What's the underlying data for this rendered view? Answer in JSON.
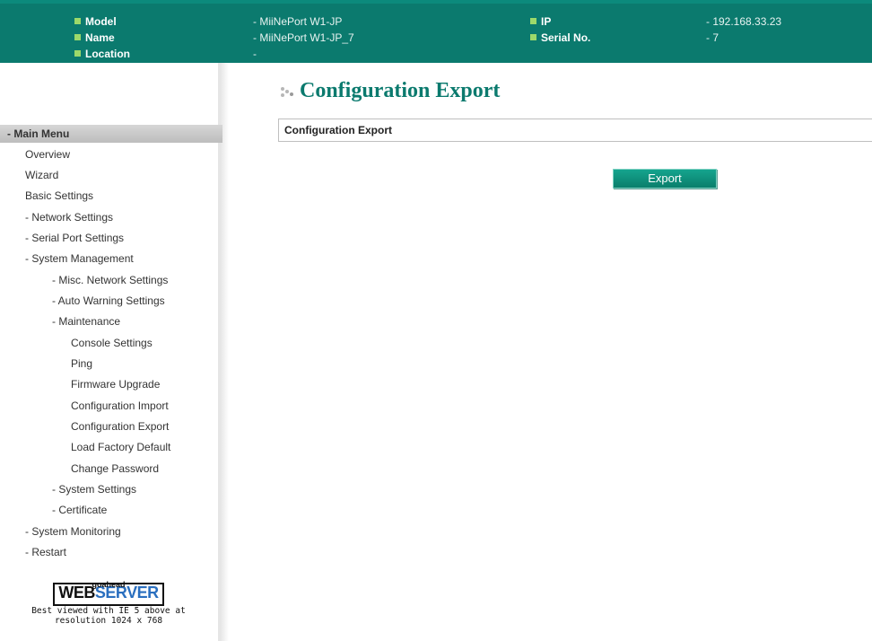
{
  "header": {
    "model_label": "Model",
    "model_value": "- MiiNePort W1-JP",
    "name_label": "Name",
    "name_value": "- MiiNePort W1-JP_7",
    "location_label": "Location",
    "location_value": "-",
    "ip_label": "IP",
    "ip_value": "- 192.168.33.23",
    "serial_label": "Serial No.",
    "serial_value": "- 7"
  },
  "sidebar": {
    "main_menu": "- Main Menu",
    "items": [
      "Overview",
      "Wizard",
      "Basic Settings",
      "- Network Settings",
      "- Serial Port Settings",
      "- System Management",
      "- Misc. Network Settings",
      "- Auto Warning Settings",
      "- Maintenance",
      "Console Settings",
      "Ping",
      "Firmware Upgrade",
      "Configuration Import",
      "Configuration Export",
      "Load Factory Default",
      "Change Password",
      "- System Settings",
      "- Certificate",
      "- System Monitoring",
      "- Restart"
    ]
  },
  "logo": {
    "top": "goahead",
    "web": "WEB",
    "server": "SERVER",
    "note_line1": "Best viewed with IE 5 above at",
    "note_line2": "resolution 1024 x 768"
  },
  "main": {
    "title": "Configuration Export",
    "section_header": "Configuration Export",
    "export_button": "Export"
  },
  "colors": {
    "brand_teal": "#0b7a6e",
    "bullet_green": "#9cd96a"
  }
}
